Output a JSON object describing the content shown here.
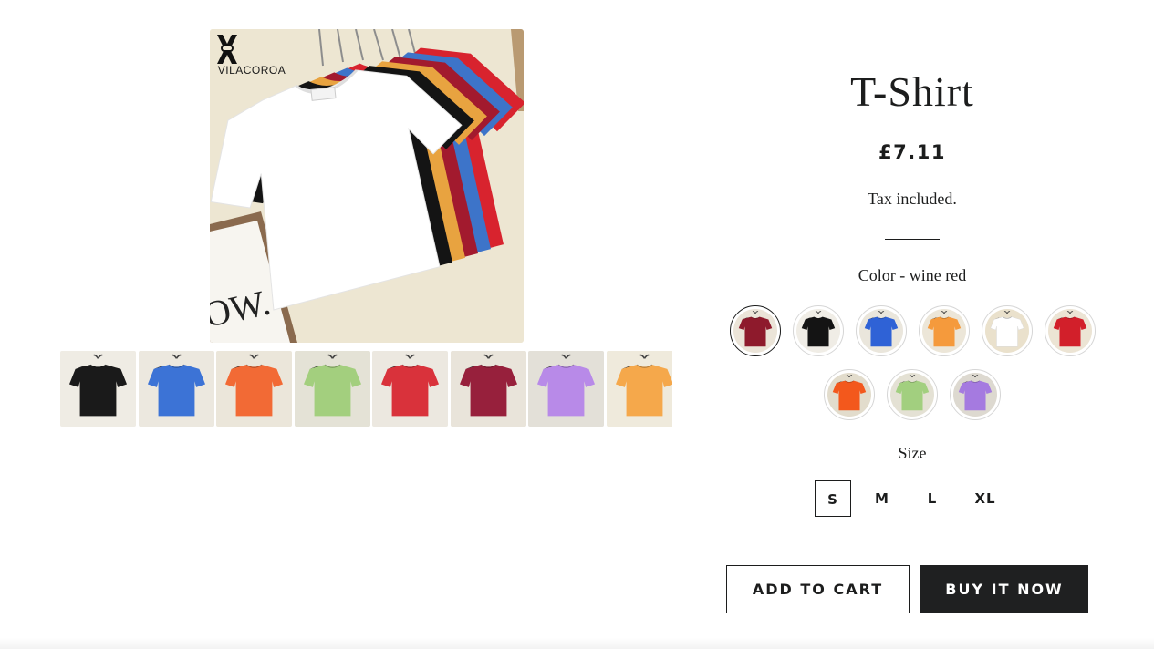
{
  "brand": {
    "name": "VILACOROA"
  },
  "product": {
    "title": "T-Shirt",
    "price": "£7.11",
    "tax_note": "Tax included.",
    "color_label": "Color - wine red",
    "size_label": "Size",
    "selected_color": "wine red",
    "selected_size": "S"
  },
  "main_image": {
    "shirts": [
      {
        "color": "#d8232e"
      },
      {
        "color": "#3d74c9"
      },
      {
        "color": "#a21a2e"
      },
      {
        "color": "#e8a340"
      },
      {
        "color": "#141414"
      },
      {
        "color": "#ffffff"
      }
    ],
    "frame_text": "OW."
  },
  "thumbnails": [
    {
      "color": "#1a1a1a",
      "bg": "#efece4"
    },
    {
      "color": "#3c73d6",
      "bg": "#ece8df"
    },
    {
      "color": "#f26a35",
      "bg": "#ebe6da"
    },
    {
      "color": "#a3cf7e",
      "bg": "#e4e2d6"
    },
    {
      "color": "#d9323b",
      "bg": "#ece8e0"
    },
    {
      "color": "#97203c",
      "bg": "#e9e4da"
    },
    {
      "color": "#b88ae8",
      "bg": "#e3e0d8"
    },
    {
      "color": "#f5a84b",
      "bg": "#efeadc"
    }
  ],
  "swatches": [
    {
      "color": "#8e1a2c",
      "bg": "#ebe4d8",
      "selected": true
    },
    {
      "color": "#141414",
      "bg": "#f0ede6"
    },
    {
      "color": "#2f62d6",
      "bg": "#eae6dc"
    },
    {
      "color": "#f59a3c",
      "bg": "#ece6d8"
    },
    {
      "color": "#ffffff",
      "bg": "#eae1cc"
    },
    {
      "color": "#d21f2a",
      "bg": "#ece4d4"
    },
    {
      "color": "#f3581c",
      "bg": "#e2dccc"
    },
    {
      "color": "#a2cf7f",
      "bg": "#e4e1d4"
    },
    {
      "color": "#a57ae0",
      "bg": "#ddd9d0"
    }
  ],
  "sizes": [
    "S",
    "M",
    "L",
    "XL"
  ],
  "buttons": {
    "add_to_cart": "ADD TO CART",
    "buy_now": "BUY IT NOW"
  }
}
